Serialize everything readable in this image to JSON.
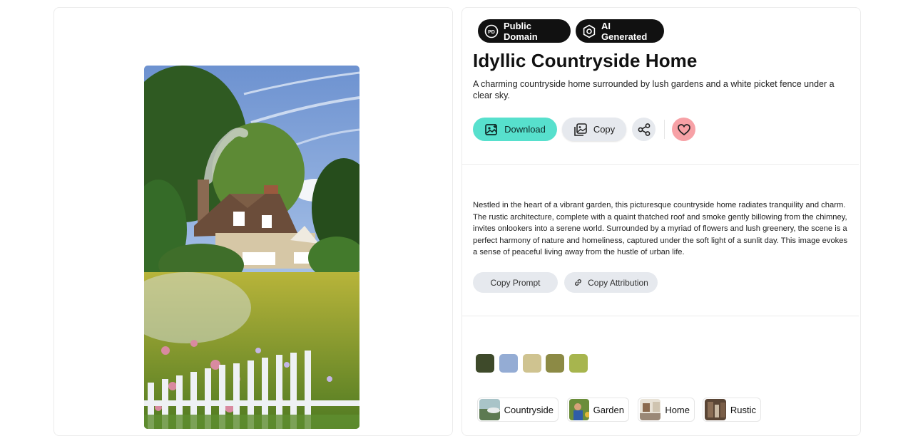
{
  "badges": {
    "public_domain": {
      "icon": "pd-icon",
      "icon_text": "PD",
      "label": "Public Domain"
    },
    "ai_generated": {
      "icon": "ai-gear-icon",
      "label": "AI Generated"
    }
  },
  "title": "Idyllic Countryside Home",
  "subtitle": "A charming countryside home surrounded by lush gardens and a white picket fence under a clear sky.",
  "actions": {
    "download_label": "Download",
    "copy_label": "Copy",
    "share_icon": "share-icon",
    "like_icon": "heart-icon"
  },
  "description": "Nestled in the heart of a vibrant garden, this picturesque countryside home radiates tranquility and charm. The rustic architecture, complete with a quaint thatched roof and smoke gently billowing from the chimney, invites onlookers into a serene world. Surrounded by a myriad of flowers and lush greenery, the scene is a perfect harmony of nature and homeliness, captured under the soft light of a sunlit day. This image evokes a sense of peaceful living away from the hustle of urban life.",
  "prompt_actions": {
    "copy_prompt_label": "Copy Prompt",
    "copy_attribution_label": "Copy Attribution"
  },
  "palette": [
    "#3e4a2a",
    "#94acd4",
    "#cfc390",
    "#8c8a45",
    "#a7b54e"
  ],
  "tags": [
    {
      "label": "Countryside"
    },
    {
      "label": "Garden"
    },
    {
      "label": "Home"
    },
    {
      "label": "Rustic"
    }
  ]
}
